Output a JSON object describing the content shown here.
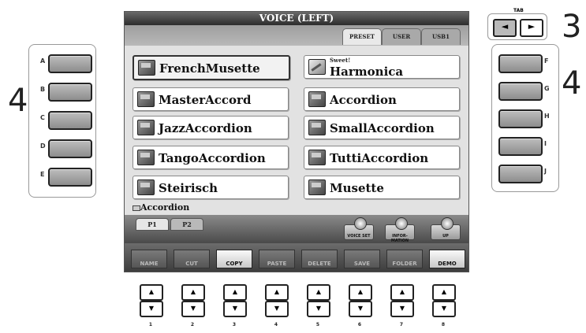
{
  "callouts": {
    "left": "4",
    "right_top": "3",
    "right": "4"
  },
  "left_buttons": [
    "A",
    "B",
    "C",
    "D",
    "E"
  ],
  "right_buttons": [
    "F",
    "G",
    "H",
    "I",
    "J"
  ],
  "tab": {
    "label": "TAB",
    "left_arrow": "◄",
    "right_arrow": "►"
  },
  "screen": {
    "title": "VOICE (LEFT)",
    "top_tabs": [
      "PRESET",
      "USER",
      "USB1"
    ],
    "voices_left": [
      "FrenchMusette",
      "MasterAccord",
      "JazzAccordion",
      "TangoAccordion",
      "Steirisch"
    ],
    "voices_right": [
      "Harmonica",
      "Accordion",
      "SmallAccordion",
      "TuttiAccordion",
      "Musette"
    ],
    "harmonica_tag": "Sweet!",
    "category": "Accordion",
    "page_tabs": [
      "P1",
      "P2"
    ],
    "function_buttons": [
      "VOICE SET",
      "INFOR-MATION",
      "UP"
    ],
    "soft_labels": [
      "NAME",
      "CUT",
      "COPY",
      "PASTE",
      "DELETE",
      "SAVE",
      "FOLDER",
      "DEMO"
    ]
  },
  "bottom_numbers": [
    "1",
    "2",
    "3",
    "4",
    "5",
    "6",
    "7",
    "8"
  ],
  "arrows": {
    "up": "▲",
    "down": "▼"
  }
}
